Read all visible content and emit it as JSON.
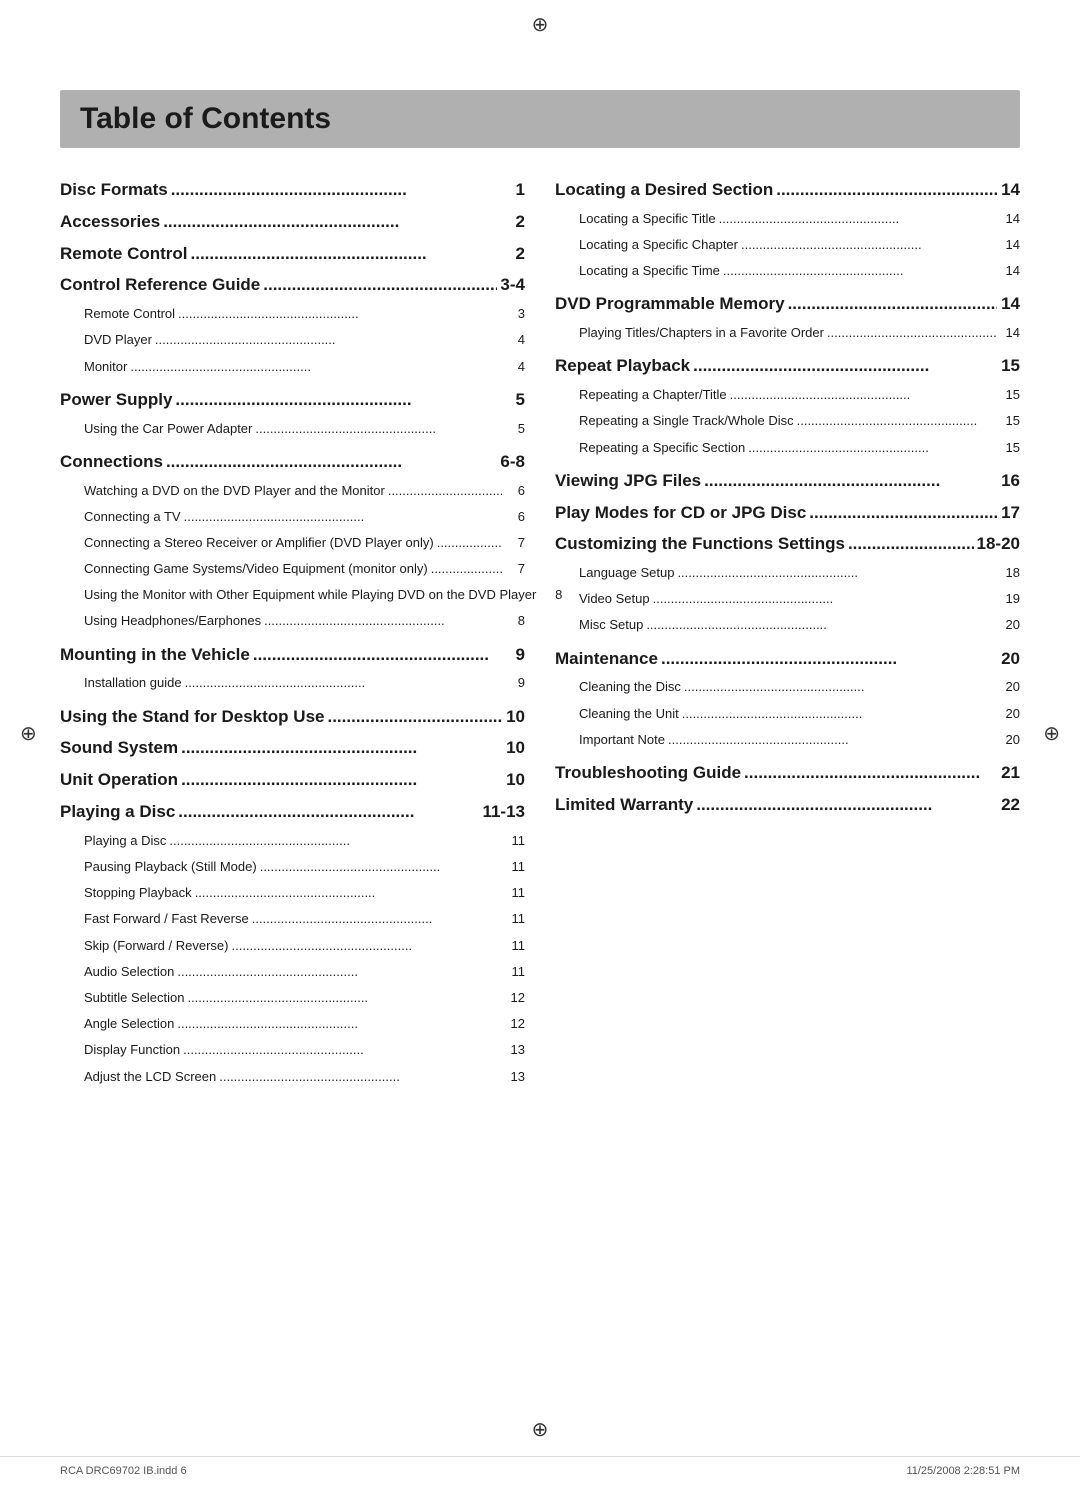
{
  "title": "Table of Contents",
  "left_column": [
    {
      "type": "main",
      "label": "Disc Formats",
      "dots": true,
      "page": "1",
      "gap": "sm"
    },
    {
      "type": "main",
      "label": "Accessories",
      "dots": true,
      "page": "2",
      "gap": "sm"
    },
    {
      "type": "main",
      "label": "Remote Control",
      "dots": true,
      "page": "2",
      "gap": "sm"
    },
    {
      "type": "main",
      "label": "Control Reference Guide",
      "dots": true,
      "page": "3-4",
      "gap": "sm"
    },
    {
      "type": "sub",
      "label": "Remote Control",
      "dots": true,
      "page": "3",
      "gap": "sm"
    },
    {
      "type": "sub",
      "label": "DVD Player",
      "dots": true,
      "page": "4",
      "gap": "sm"
    },
    {
      "type": "sub",
      "label": "Monitor",
      "dots": true,
      "page": "4",
      "gap": "lg"
    },
    {
      "type": "main",
      "label": "Power Supply",
      "dots": true,
      "page": "5",
      "gap": "sm"
    },
    {
      "type": "sub",
      "label": "Using the Car Power Adapter",
      "dots": true,
      "page": "5",
      "gap": "lg"
    },
    {
      "type": "main",
      "label": "Connections",
      "dots": true,
      "page": "6-8",
      "gap": "sm"
    },
    {
      "type": "sub",
      "label": "Watching a DVD on the DVD Player and the Monitor",
      "dots": true,
      "page": "6",
      "gap": "sm"
    },
    {
      "type": "sub",
      "label": "Connecting a TV",
      "dots": true,
      "page": "6",
      "gap": "sm"
    },
    {
      "type": "sub",
      "label": "Connecting a Stereo Receiver or Amplifier (DVD Player only)",
      "dots": true,
      "page": "7",
      "gap": "sm"
    },
    {
      "type": "sub",
      "label": "Connecting Game Systems/Video Equipment (monitor only)",
      "dots": true,
      "page": "7",
      "gap": "sm"
    },
    {
      "type": "sub",
      "label": "Using the Monitor with Other Equipment while Playing DVD on the DVD Player",
      "dots": true,
      "page": "8",
      "gap": "sm"
    },
    {
      "type": "sub",
      "label": "Using Headphones/Earphones",
      "dots": true,
      "page": "8",
      "gap": "lg"
    },
    {
      "type": "main",
      "label": "Mounting in the Vehicle",
      "dots": true,
      "page": "9",
      "gap": "sm"
    },
    {
      "type": "sub",
      "label": "Installation guide",
      "dots": true,
      "page": "9",
      "gap": "lg"
    },
    {
      "type": "main",
      "label": "Using the Stand for Desktop Use",
      "dots": true,
      "page": "10",
      "gap": "sm"
    },
    {
      "type": "main",
      "label": "Sound System",
      "dots": true,
      "page": "10",
      "gap": "sm"
    },
    {
      "type": "main",
      "label": "Unit Operation",
      "dots": true,
      "page": "10",
      "gap": "sm"
    },
    {
      "type": "main",
      "label": "Playing a Disc",
      "dots": true,
      "page": "11-13",
      "gap": "sm"
    },
    {
      "type": "sub",
      "label": "Playing a Disc",
      "dots": true,
      "page": "11",
      "gap": "sm"
    },
    {
      "type": "sub",
      "label": "Pausing Playback (Still Mode)",
      "dots": true,
      "page": "11",
      "gap": "sm"
    },
    {
      "type": "sub",
      "label": "Stopping Playback",
      "dots": true,
      "page": "11",
      "gap": "sm"
    },
    {
      "type": "sub",
      "label": "Fast Forward / Fast Reverse",
      "dots": true,
      "page": "11",
      "gap": "sm"
    },
    {
      "type": "sub",
      "label": "Skip (Forward / Reverse)",
      "dots": true,
      "page": "11",
      "gap": "sm"
    },
    {
      "type": "sub",
      "label": "Audio  Selection",
      "dots": true,
      "page": "11",
      "gap": "sm"
    },
    {
      "type": "sub",
      "label": "Subtitle Selection",
      "dots": true,
      "page": "12",
      "gap": "sm"
    },
    {
      "type": "sub",
      "label": "Angle Selection",
      "dots": true,
      "page": "12",
      "gap": "sm"
    },
    {
      "type": "sub",
      "label": "Display Function",
      "dots": true,
      "page": "13",
      "gap": "sm"
    },
    {
      "type": "sub",
      "label": "Adjust the LCD Screen",
      "dots": true,
      "page": "13",
      "gap": "sm"
    }
  ],
  "right_column": [
    {
      "type": "main",
      "label": "Locating a Desired Section",
      "dots": true,
      "page": "14",
      "gap": "sm"
    },
    {
      "type": "sub",
      "label": "Locating a Specific Title",
      "dots": true,
      "page": "14",
      "gap": "sm"
    },
    {
      "type": "sub",
      "label": "Locating a Specific Chapter",
      "dots": true,
      "page": "14",
      "gap": "sm"
    },
    {
      "type": "sub",
      "label": "Locating a Specific Time",
      "dots": true,
      "page": "14",
      "gap": "lg"
    },
    {
      "type": "main",
      "label": "DVD Programmable Memory",
      "dots": true,
      "page": "14",
      "gap": "sm"
    },
    {
      "type": "sub",
      "label": "Playing Titles/Chapters in a Favorite Order",
      "dots": true,
      "page": "14",
      "gap": "lg"
    },
    {
      "type": "main",
      "label": "Repeat Playback",
      "dots": true,
      "page": "15",
      "gap": "sm"
    },
    {
      "type": "sub",
      "label": "Repeating a Chapter/Title",
      "dots": true,
      "page": "15",
      "gap": "sm"
    },
    {
      "type": "sub",
      "label": "Repeating a Single Track/Whole Disc",
      "dots": true,
      "page": "15",
      "gap": "sm"
    },
    {
      "type": "sub",
      "label": "Repeating a Specific Section",
      "dots": true,
      "page": "15",
      "gap": "lg"
    },
    {
      "type": "main",
      "label": "Viewing JPG Files",
      "dots": true,
      "page": "16",
      "gap": "sm"
    },
    {
      "type": "main",
      "label": "Play Modes for CD or JPG Disc",
      "dots": true,
      "page": "17",
      "gap": "sm"
    },
    {
      "type": "main",
      "label": "Customizing the Functions Settings",
      "dots": true,
      "page": "18-20",
      "gap": "sm"
    },
    {
      "type": "sub",
      "label": "Language Setup",
      "dots": true,
      "page": "18",
      "gap": "sm"
    },
    {
      "type": "sub",
      "label": "Video Setup",
      "dots": true,
      "page": "19",
      "gap": "sm"
    },
    {
      "type": "sub",
      "label": "Misc Setup",
      "dots": true,
      "page": "20",
      "gap": "lg"
    },
    {
      "type": "main",
      "label": "Maintenance",
      "dots": true,
      "page": "20",
      "gap": "sm"
    },
    {
      "type": "sub",
      "label": "Cleaning the Disc",
      "dots": true,
      "page": "20",
      "gap": "sm"
    },
    {
      "type": "sub",
      "label": "Cleaning the Unit",
      "dots": true,
      "page": "20",
      "gap": "sm"
    },
    {
      "type": "sub",
      "label": "Important Note",
      "dots": true,
      "page": "20",
      "gap": "lg"
    },
    {
      "type": "main",
      "label": "Troubleshooting Guide",
      "dots": true,
      "page": "21",
      "gap": "sm"
    },
    {
      "type": "main",
      "label": "Limited Warranty",
      "dots": true,
      "page": "22",
      "gap": "sm"
    }
  ],
  "footer": {
    "left": "RCA DRC69702 IB.indd   6",
    "right": "11/25/2008   2:28:51 PM"
  }
}
